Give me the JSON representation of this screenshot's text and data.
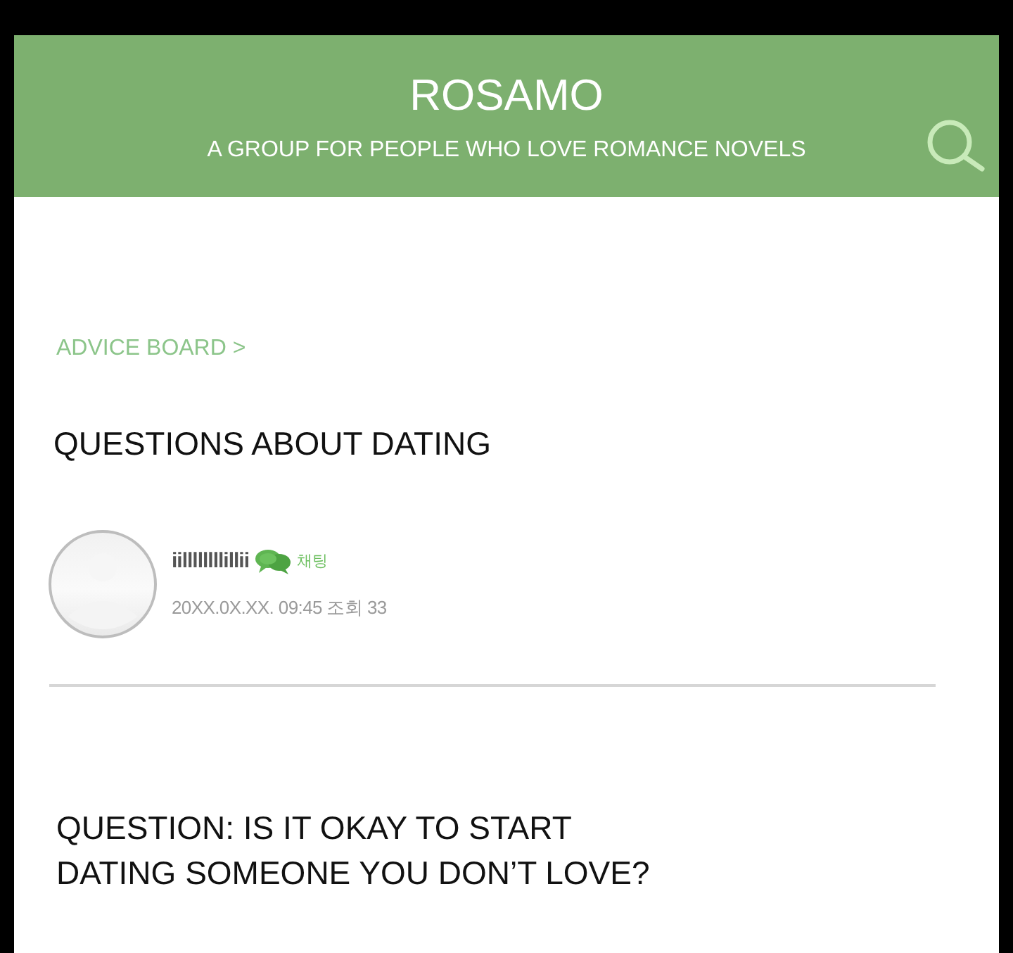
{
  "header": {
    "title": "ROSAMO",
    "subtitle": "A GROUP FOR PEOPLE WHO LOVE ROMANCE NOVELS"
  },
  "breadcrumb": "ADVICE BOARD >",
  "post": {
    "title": "QUESTIONS ABOUT DATING",
    "author": {
      "name": "iillllllllillii",
      "badge": "채팅",
      "meta": "20XX.0X.XX. 09:45 조회 33"
    },
    "body": "QUESTION: IS IT OKAY TO START DATING SOMEONE YOU DON’T LOVE?"
  }
}
